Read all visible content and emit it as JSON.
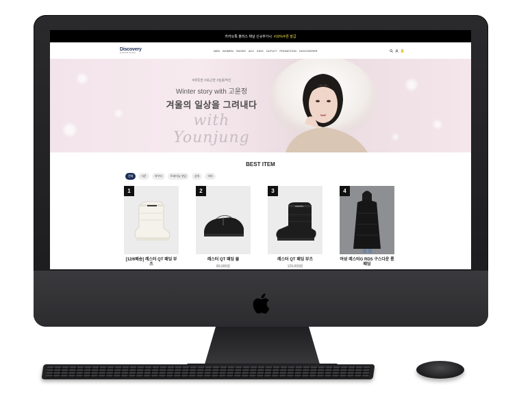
{
  "promo_bar": {
    "text": "카카오톡 플러스 채널 신규추가시",
    "highlight": "#10%쿠폰 발급"
  },
  "header": {
    "logo": "Discovery",
    "logo_sub": "EXPEDITION",
    "nav": [
      "MEN",
      "WOMEN",
      "SHOES",
      "ACC",
      "KIDS",
      "OUTLET",
      "PROMOTION",
      "DISCOVERER"
    ],
    "icons": [
      "search-icon",
      "user-icon",
      "cart-icon"
    ]
  },
  "hero": {
    "tags": "#따뜻한 #포근한 #실용적인",
    "subtitle": "Winter story with 고윤정",
    "title": "겨울의 일상을 그려내다",
    "script": "with Younjung"
  },
  "best": {
    "title": "BEST ITEM",
    "chips": [
      "전체",
      "다운",
      "아우터",
      "트레이닝 셋업",
      "상의",
      "하의"
    ],
    "active_chip": 0,
    "products": [
      {
        "rank": "1",
        "name": "[12/6배송] 레스터 QT 패딩 부츠",
        "price": ""
      },
      {
        "rank": "2",
        "name": "레스터 QT 패딩 뮬",
        "price": "89,000원"
      },
      {
        "rank": "3",
        "name": "레스터 QT 패딩 부츠",
        "price": "129,000원"
      },
      {
        "rank": "4",
        "name": "여성 레스터G RDS 구스다운 롱패딩",
        "price": ""
      }
    ]
  },
  "colors": {
    "brand_navy": "#1c2f5a",
    "promo_highlight": "#f5e04a",
    "hardware": "#2a2a2c"
  }
}
